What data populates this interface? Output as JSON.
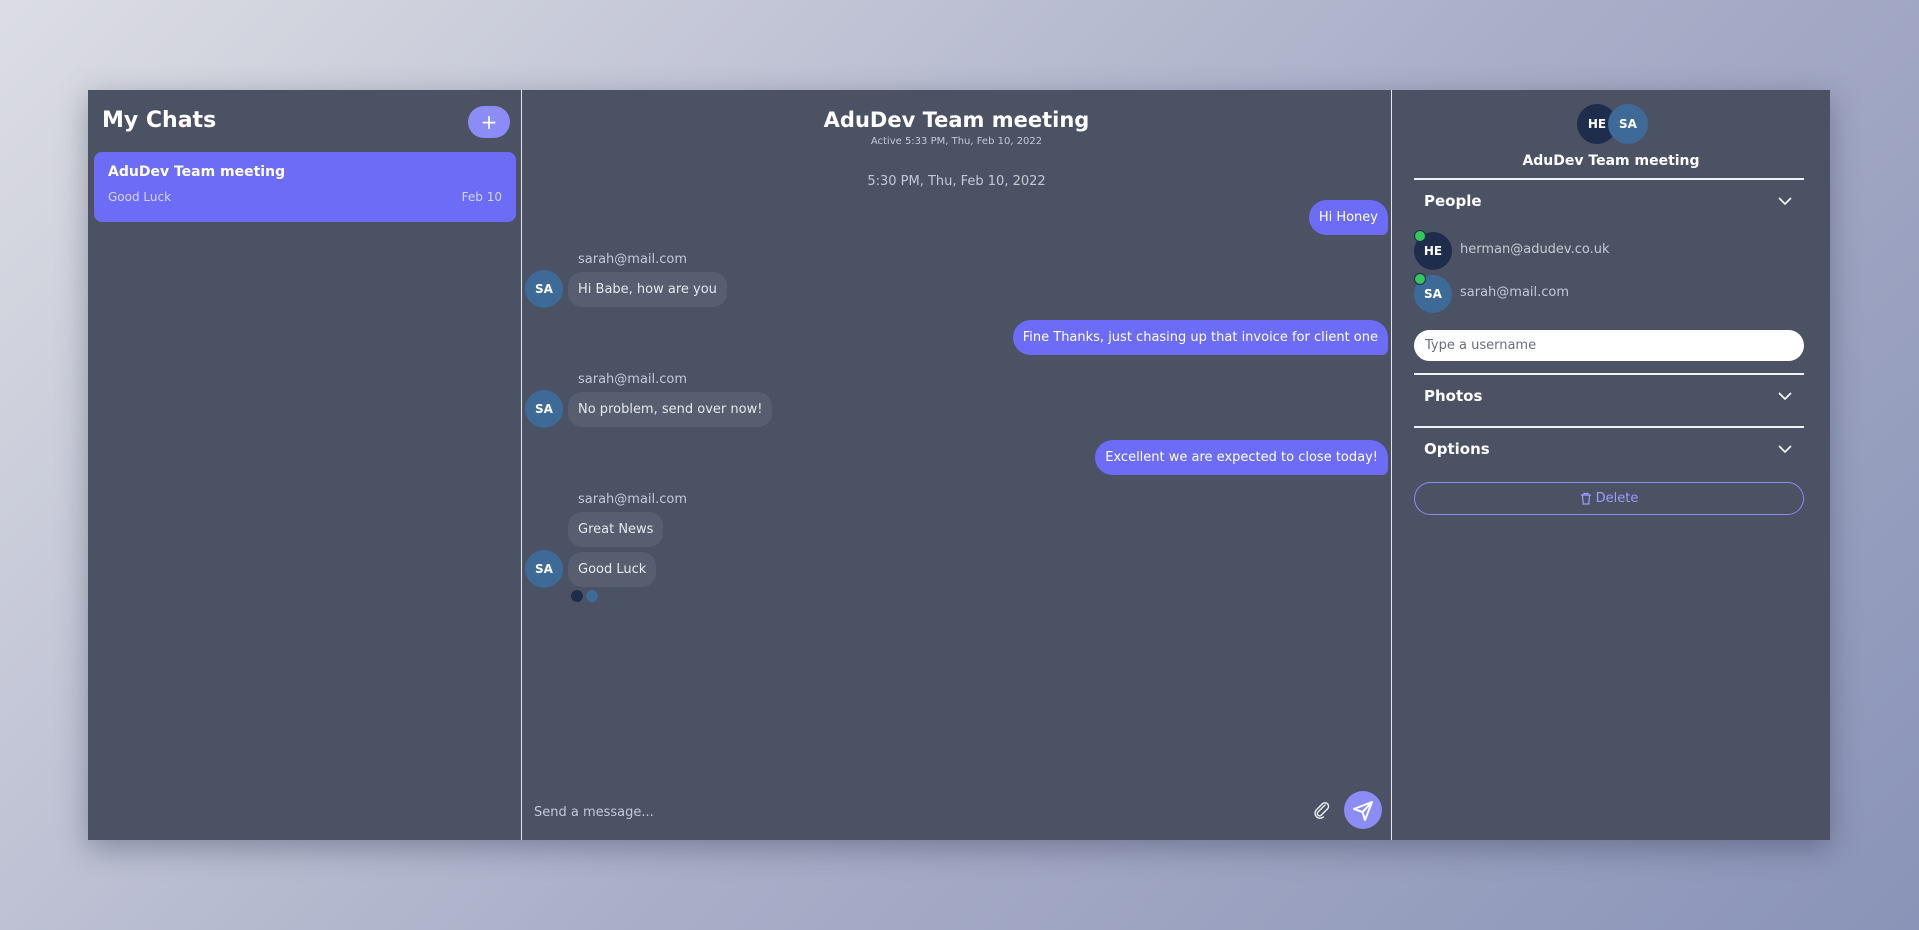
{
  "sidebar": {
    "title": "My Chats",
    "add_label": "+",
    "chats": [
      {
        "name": "AduDev Team meeting",
        "last_message": "Good Luck",
        "date": "Feb 10"
      }
    ]
  },
  "chat": {
    "title": "AduDev Team meeting",
    "active": "Active 5:33 PM, Thu, Feb 10, 2022",
    "timestamp": "5:30 PM, Thu, Feb 10, 2022",
    "messages": [
      {
        "from": "me",
        "text": "Hi Honey"
      },
      {
        "from": "sarah@mail.com",
        "avatar": "SA",
        "text": "Hi Babe, how are you"
      },
      {
        "from": "me",
        "text": "Fine Thanks, just chasing up that invoice for client one"
      },
      {
        "from": "sarah@mail.com",
        "avatar": "SA",
        "text": "No problem, send over now!"
      },
      {
        "from": "me",
        "text": "Excellent we are expected to close today!"
      },
      {
        "from": "sarah@mail.com",
        "avatar": "SA",
        "text": "Great News"
      },
      {
        "from": "sarah@mail.com",
        "avatar": "SA",
        "text": "Good Luck"
      }
    ],
    "composer_placeholder": "Send a message..."
  },
  "details": {
    "avatars": [
      "HE",
      "SA"
    ],
    "title": "AduDev Team meeting",
    "people_label": "People",
    "people": [
      {
        "initials": "HE",
        "email": "herman@adudev.co.uk"
      },
      {
        "initials": "SA",
        "email": "sarah@mail.com"
      }
    ],
    "username_placeholder": "Type a username",
    "photos_label": "Photos",
    "options_label": "Options",
    "delete_label": "Delete"
  },
  "colors": {
    "accent": "#6c6cf6",
    "panel": "#4b5263",
    "online": "#35c759"
  }
}
